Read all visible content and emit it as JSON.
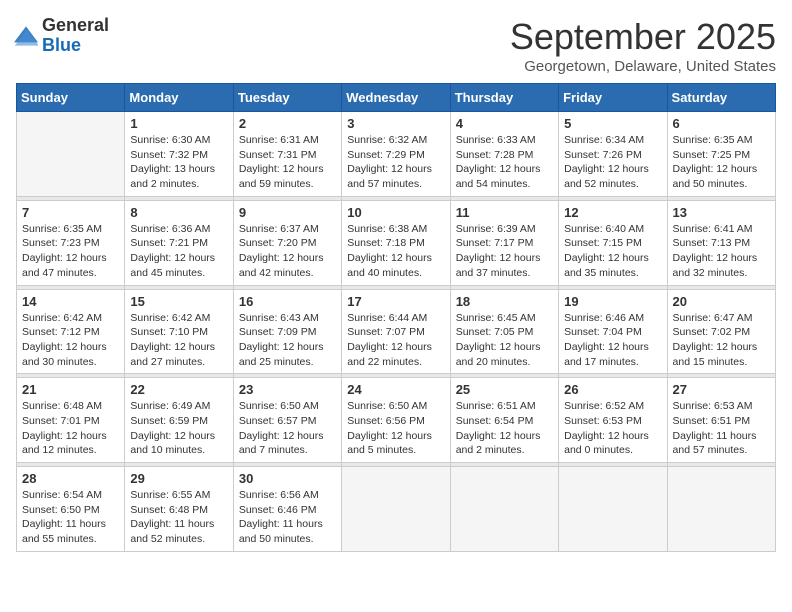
{
  "logo": {
    "general": "General",
    "blue": "Blue"
  },
  "title": "September 2025",
  "location": "Georgetown, Delaware, United States",
  "days_of_week": [
    "Sunday",
    "Monday",
    "Tuesday",
    "Wednesday",
    "Thursday",
    "Friday",
    "Saturday"
  ],
  "weeks": [
    [
      {
        "day": "",
        "info": ""
      },
      {
        "day": "1",
        "info": "Sunrise: 6:30 AM\nSunset: 7:32 PM\nDaylight: 13 hours\nand 2 minutes."
      },
      {
        "day": "2",
        "info": "Sunrise: 6:31 AM\nSunset: 7:31 PM\nDaylight: 12 hours\nand 59 minutes."
      },
      {
        "day": "3",
        "info": "Sunrise: 6:32 AM\nSunset: 7:29 PM\nDaylight: 12 hours\nand 57 minutes."
      },
      {
        "day": "4",
        "info": "Sunrise: 6:33 AM\nSunset: 7:28 PM\nDaylight: 12 hours\nand 54 minutes."
      },
      {
        "day": "5",
        "info": "Sunrise: 6:34 AM\nSunset: 7:26 PM\nDaylight: 12 hours\nand 52 minutes."
      },
      {
        "day": "6",
        "info": "Sunrise: 6:35 AM\nSunset: 7:25 PM\nDaylight: 12 hours\nand 50 minutes."
      }
    ],
    [
      {
        "day": "7",
        "info": "Sunrise: 6:35 AM\nSunset: 7:23 PM\nDaylight: 12 hours\nand 47 minutes."
      },
      {
        "day": "8",
        "info": "Sunrise: 6:36 AM\nSunset: 7:21 PM\nDaylight: 12 hours\nand 45 minutes."
      },
      {
        "day": "9",
        "info": "Sunrise: 6:37 AM\nSunset: 7:20 PM\nDaylight: 12 hours\nand 42 minutes."
      },
      {
        "day": "10",
        "info": "Sunrise: 6:38 AM\nSunset: 7:18 PM\nDaylight: 12 hours\nand 40 minutes."
      },
      {
        "day": "11",
        "info": "Sunrise: 6:39 AM\nSunset: 7:17 PM\nDaylight: 12 hours\nand 37 minutes."
      },
      {
        "day": "12",
        "info": "Sunrise: 6:40 AM\nSunset: 7:15 PM\nDaylight: 12 hours\nand 35 minutes."
      },
      {
        "day": "13",
        "info": "Sunrise: 6:41 AM\nSunset: 7:13 PM\nDaylight: 12 hours\nand 32 minutes."
      }
    ],
    [
      {
        "day": "14",
        "info": "Sunrise: 6:42 AM\nSunset: 7:12 PM\nDaylight: 12 hours\nand 30 minutes."
      },
      {
        "day": "15",
        "info": "Sunrise: 6:42 AM\nSunset: 7:10 PM\nDaylight: 12 hours\nand 27 minutes."
      },
      {
        "day": "16",
        "info": "Sunrise: 6:43 AM\nSunset: 7:09 PM\nDaylight: 12 hours\nand 25 minutes."
      },
      {
        "day": "17",
        "info": "Sunrise: 6:44 AM\nSunset: 7:07 PM\nDaylight: 12 hours\nand 22 minutes."
      },
      {
        "day": "18",
        "info": "Sunrise: 6:45 AM\nSunset: 7:05 PM\nDaylight: 12 hours\nand 20 minutes."
      },
      {
        "day": "19",
        "info": "Sunrise: 6:46 AM\nSunset: 7:04 PM\nDaylight: 12 hours\nand 17 minutes."
      },
      {
        "day": "20",
        "info": "Sunrise: 6:47 AM\nSunset: 7:02 PM\nDaylight: 12 hours\nand 15 minutes."
      }
    ],
    [
      {
        "day": "21",
        "info": "Sunrise: 6:48 AM\nSunset: 7:01 PM\nDaylight: 12 hours\nand 12 minutes."
      },
      {
        "day": "22",
        "info": "Sunrise: 6:49 AM\nSunset: 6:59 PM\nDaylight: 12 hours\nand 10 minutes."
      },
      {
        "day": "23",
        "info": "Sunrise: 6:50 AM\nSunset: 6:57 PM\nDaylight: 12 hours\nand 7 minutes."
      },
      {
        "day": "24",
        "info": "Sunrise: 6:50 AM\nSunset: 6:56 PM\nDaylight: 12 hours\nand 5 minutes."
      },
      {
        "day": "25",
        "info": "Sunrise: 6:51 AM\nSunset: 6:54 PM\nDaylight: 12 hours\nand 2 minutes."
      },
      {
        "day": "26",
        "info": "Sunrise: 6:52 AM\nSunset: 6:53 PM\nDaylight: 12 hours\nand 0 minutes."
      },
      {
        "day": "27",
        "info": "Sunrise: 6:53 AM\nSunset: 6:51 PM\nDaylight: 11 hours\nand 57 minutes."
      }
    ],
    [
      {
        "day": "28",
        "info": "Sunrise: 6:54 AM\nSunset: 6:50 PM\nDaylight: 11 hours\nand 55 minutes."
      },
      {
        "day": "29",
        "info": "Sunrise: 6:55 AM\nSunset: 6:48 PM\nDaylight: 11 hours\nand 52 minutes."
      },
      {
        "day": "30",
        "info": "Sunrise: 6:56 AM\nSunset: 6:46 PM\nDaylight: 11 hours\nand 50 minutes."
      },
      {
        "day": "",
        "info": ""
      },
      {
        "day": "",
        "info": ""
      },
      {
        "day": "",
        "info": ""
      },
      {
        "day": "",
        "info": ""
      }
    ]
  ]
}
